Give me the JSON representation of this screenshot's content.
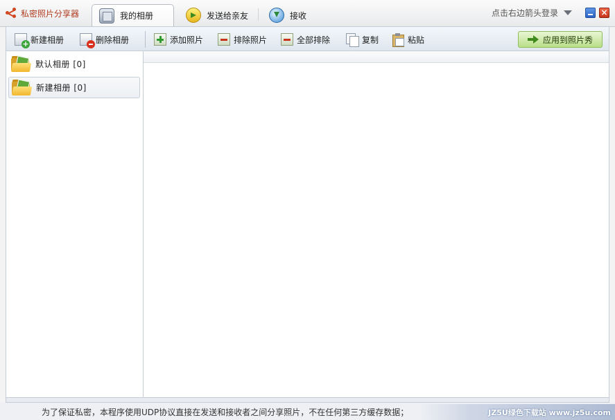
{
  "app": {
    "title": "私密照片分享器"
  },
  "tabs": [
    {
      "label": "我的相册",
      "icon": "album-icon",
      "active": true
    },
    {
      "label": "发送给亲友",
      "icon": "send-icon",
      "active": false
    },
    {
      "label": "接收",
      "icon": "receive-icon",
      "active": false
    }
  ],
  "login": {
    "label": "点击右边箭头登录"
  },
  "toolbar": {
    "new_album": "新建相册",
    "delete_album": "删除相册",
    "add_photo": "添加照片",
    "remove_photo": "排除照片",
    "remove_all": "全部排除",
    "copy": "复制",
    "paste": "粘贴",
    "apply": "应用到照片秀"
  },
  "albums": [
    {
      "label": "默认相册 [0]",
      "selected": false
    },
    {
      "label": "新建相册 [0]",
      "selected": true
    }
  ],
  "status": {
    "text": "为了保证私密，本程序使用UDP协议直接在发送和接收者之间分享照片，不在任何第三方缓存数据；",
    "watermark": "JZ5U绿色下载站 www.jz5u.com"
  },
  "colors": {
    "accent_green": "#b9de88",
    "title_red": "#b03c1f"
  }
}
